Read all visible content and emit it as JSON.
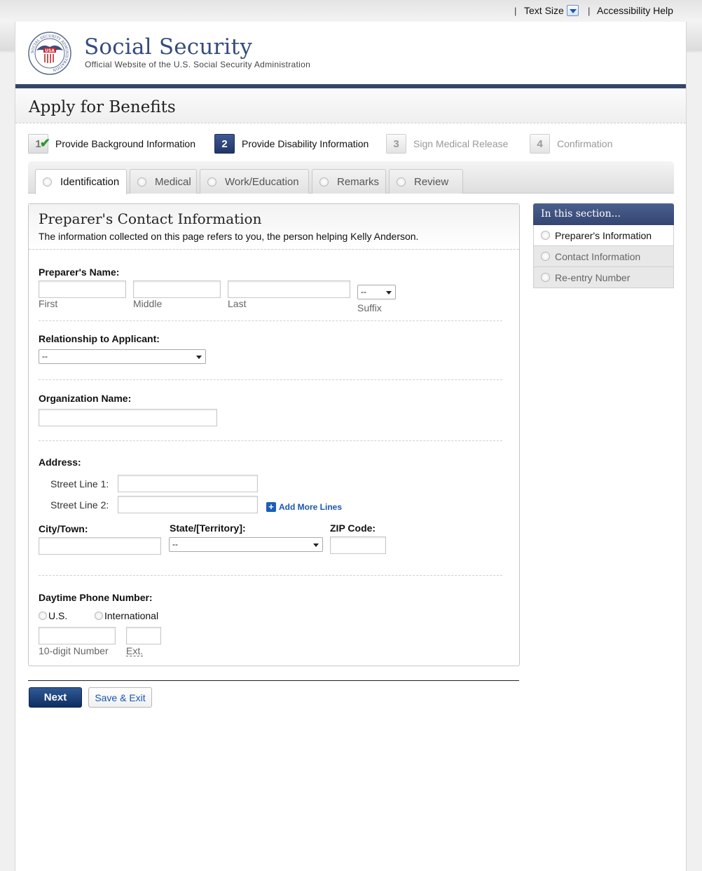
{
  "utility": {
    "separator": "|",
    "text_size": "Text Size",
    "accessibility_help": "Accessibility Help"
  },
  "header": {
    "title": "Social Security",
    "subtitle": "Official Website of the U.S. Social Security Administration",
    "seal_text": "SOCIAL SECURITY ADMINISTRATION",
    "seal_badge": "USA"
  },
  "page_title": "Apply for Benefits",
  "steps": [
    {
      "num": "1",
      "label": "Provide Background Information",
      "state": "done"
    },
    {
      "num": "2",
      "label": "Provide Disability Information",
      "state": "active"
    },
    {
      "num": "3",
      "label": "Sign Medical Release",
      "state": "future"
    },
    {
      "num": "4",
      "label": "Confirmation",
      "state": "future"
    }
  ],
  "tabs": [
    {
      "label": "Identification"
    },
    {
      "label": "Medical"
    },
    {
      "label": "Work/Education"
    },
    {
      "label": "Remarks"
    },
    {
      "label": "Review"
    }
  ],
  "section": {
    "title": "Preparer's Contact Information",
    "intro": "The information collected on this page refers to you, the person helping Kelly Anderson."
  },
  "form": {
    "name_label": "Preparer's Name:",
    "first": "First",
    "middle": "Middle",
    "last": "Last",
    "suffix_label": "Suffix",
    "suffix_value": "--",
    "relationship_label": "Relationship to Applicant:",
    "relationship_value": "--",
    "org_label": "Organization Name:",
    "address_label": "Address:",
    "street1": "Street Line 1:",
    "street2": "Street Line 2:",
    "add_more": "Add More Lines",
    "city_label": "City/Town:",
    "state_label": "State/[Territory]:",
    "state_value": "--",
    "zip_label": "ZIP Code:",
    "phone_label": "Daytime Phone Number:",
    "phone_us": "U.S.",
    "phone_intl": "International",
    "phone_number": "10-digit Number",
    "phone_ext": "Ext."
  },
  "buttons": {
    "next": "Next",
    "save_exit": "Save & Exit"
  },
  "sidenav": {
    "heading": "In this section...",
    "items": [
      {
        "label": "Preparer's Information"
      },
      {
        "label": "Contact Information"
      },
      {
        "label": "Re-entry Number"
      }
    ]
  }
}
